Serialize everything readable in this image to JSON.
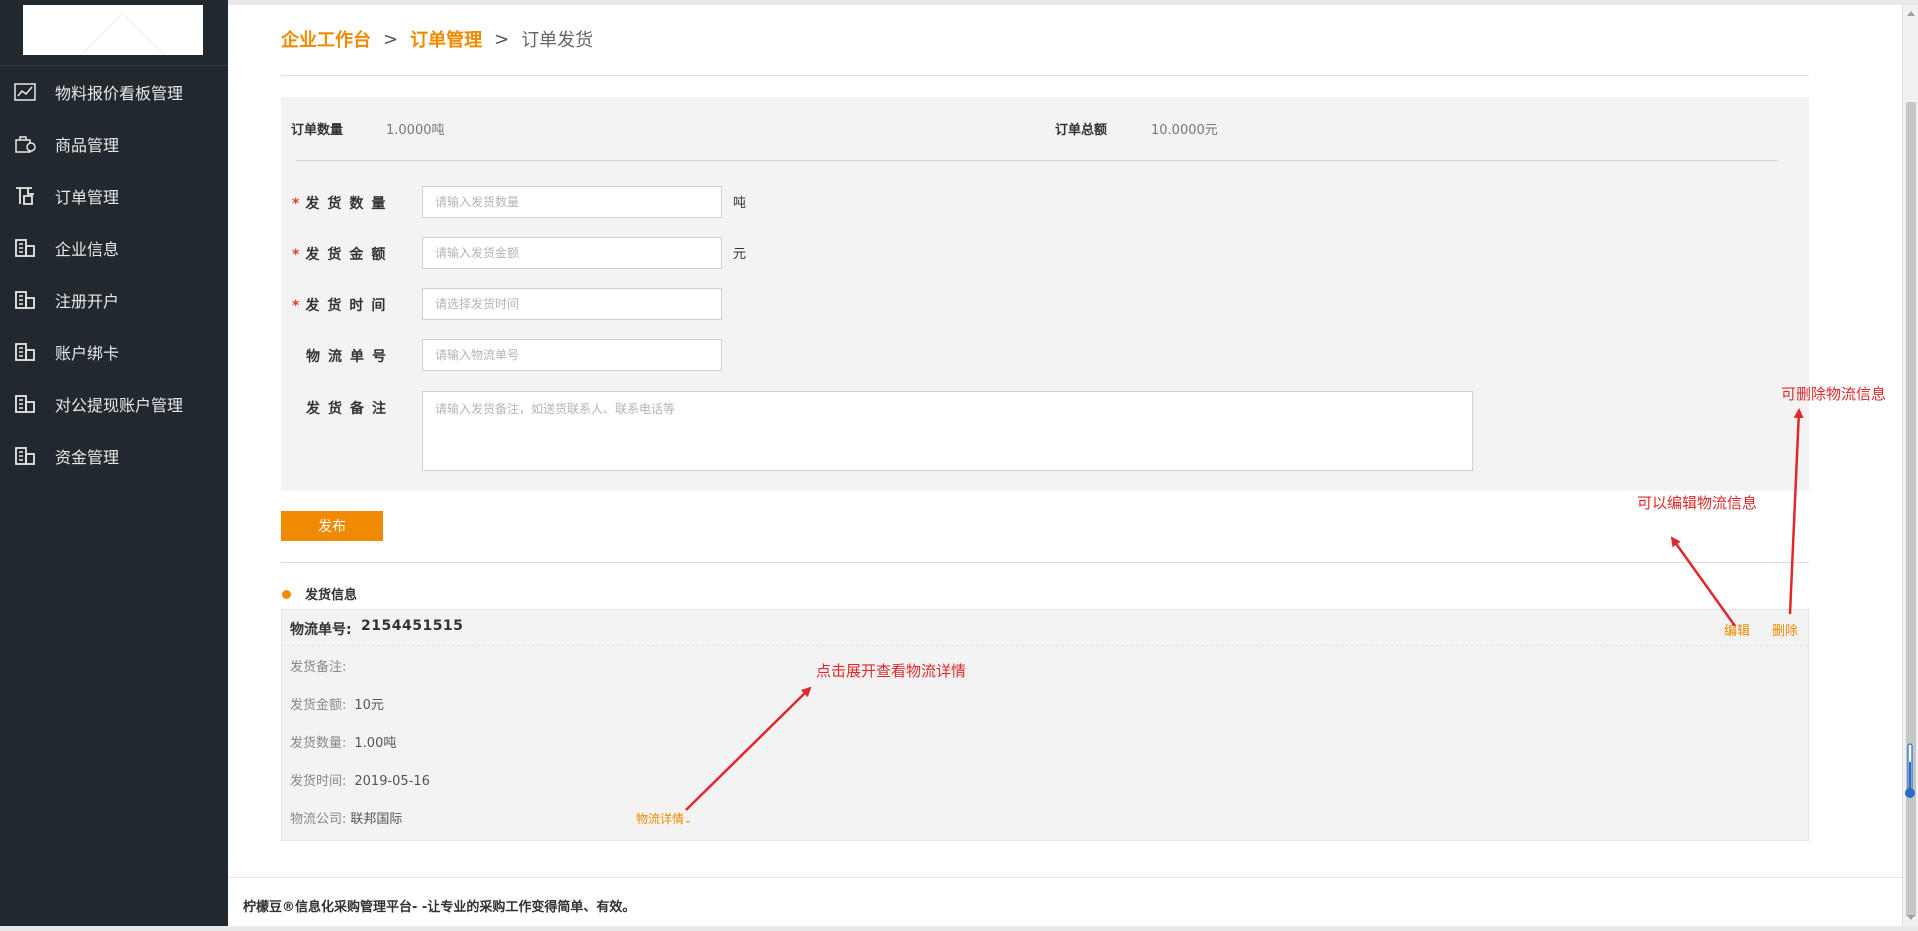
{
  "sidebar": {
    "items": [
      {
        "label": "物料报价看板管理",
        "icon": "chart-board-icon"
      },
      {
        "label": "商品管理",
        "icon": "goods-icon"
      },
      {
        "label": "订单管理",
        "icon": "order-icon"
      },
      {
        "label": "企业信息",
        "icon": "building-icon"
      },
      {
        "label": "注册开户",
        "icon": "building-icon"
      },
      {
        "label": "账户绑卡",
        "icon": "building-icon"
      },
      {
        "label": "对公提现账户管理",
        "icon": "building-icon"
      },
      {
        "label": "资金管理",
        "icon": "building-icon"
      }
    ]
  },
  "breadcrumb": {
    "home": "企业工作台",
    "sep1": ">",
    "section": "订单管理",
    "sep2": ">",
    "current": "订单发货"
  },
  "summary": {
    "qty_label": "订单数量",
    "qty_value": "1.0000吨",
    "total_label": "订单总额",
    "total_value": "10.0000元"
  },
  "form": {
    "ship_qty": {
      "label": "发货数量",
      "placeholder": "请输入发货数量",
      "value": "",
      "unit": "吨"
    },
    "ship_amount": {
      "label": "发货金额",
      "placeholder": "请输入发货金额",
      "value": "",
      "unit": "元"
    },
    "ship_time": {
      "label": "发货时间",
      "placeholder": "请选择发货时间",
      "value": ""
    },
    "tracking_no": {
      "label": "物流单号",
      "placeholder": "请输入物流单号",
      "value": ""
    },
    "remark": {
      "label": "发货备注",
      "placeholder": "请输入发货备注，如送货联系人、联系电话等",
      "value": ""
    },
    "required_mark": "*",
    "publish_label": "发布"
  },
  "shipping": {
    "section_title": "发货信息",
    "tracking_label": "物流单号:",
    "tracking_no": "2154451515",
    "edit_label": "编辑",
    "delete_label": "删除",
    "remark_label": "发货备注:",
    "remark_value": "",
    "amount_label": "发货金额:",
    "amount_value": "10元",
    "qty_label": "发货数量:",
    "qty_value": "1.00吨",
    "time_label": "发货时间:",
    "time_value": "2019-05-16",
    "company_label": "物流公司:",
    "company_value": "联邦国际",
    "detail_link": "物流详情"
  },
  "annotations": {
    "expand": "点击展开查看物流详情",
    "edit": "可以编辑物流信息",
    "delete": "可删除物流信息"
  },
  "footer": {
    "text": "柠檬豆®信息化采购管理平台- -让专业的采购工作变得简单、有效。"
  },
  "colors": {
    "accent": "#f08a00",
    "sidebar_bg": "#21292e",
    "annotation": "#e0282a",
    "required": "#e23b2f"
  }
}
